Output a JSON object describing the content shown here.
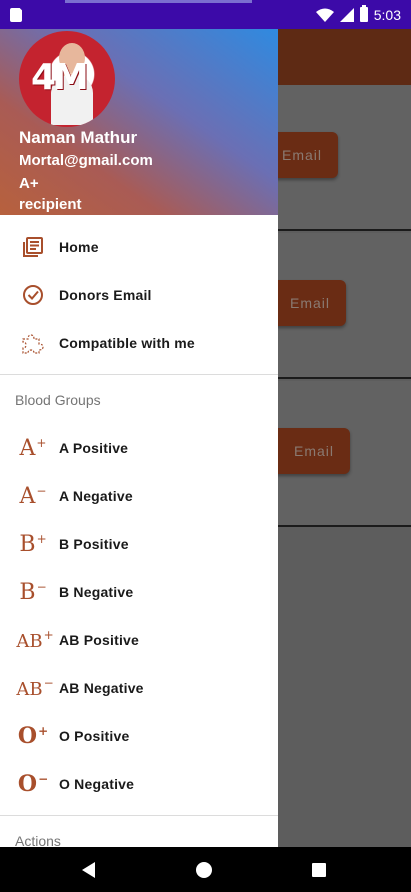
{
  "status_bar": {
    "time": "5:03"
  },
  "background": {
    "buttons": [
      {
        "label": "Email"
      },
      {
        "label": "Email"
      },
      {
        "label": "Email"
      }
    ]
  },
  "drawer": {
    "header": {
      "avatar_logo": "4M",
      "name": "Naman Mathur",
      "email": "Mortal@gmail.com",
      "blood_group": "A+",
      "role": "recipient"
    },
    "main_items": [
      {
        "label": "Home",
        "icon": "news-icon"
      },
      {
        "label": "Donors Email",
        "icon": "check-circle-icon"
      },
      {
        "label": "Compatible with me",
        "icon": "puzzle-icon"
      }
    ],
    "blood_groups_title": "Blood Groups",
    "blood_groups": [
      {
        "label": "A Positive",
        "glyph": "A",
        "sign": "+"
      },
      {
        "label": "A Negative",
        "glyph": "A",
        "sign": "−"
      },
      {
        "label": "B Positive",
        "glyph": "B",
        "sign": "+"
      },
      {
        "label": "B Negative",
        "glyph": "B",
        "sign": "−"
      },
      {
        "label": "AB Positive",
        "glyph": "AB",
        "sign": "+"
      },
      {
        "label": "AB Negative",
        "glyph": "AB",
        "sign": "−"
      },
      {
        "label": "O Positive",
        "glyph": "O",
        "sign": "+"
      },
      {
        "label": "O Negative",
        "glyph": "O",
        "sign": "−"
      }
    ],
    "actions_title": "Actions"
  },
  "colors": {
    "accent": "#a84f2c",
    "status_bar": "#3c0aa8"
  }
}
